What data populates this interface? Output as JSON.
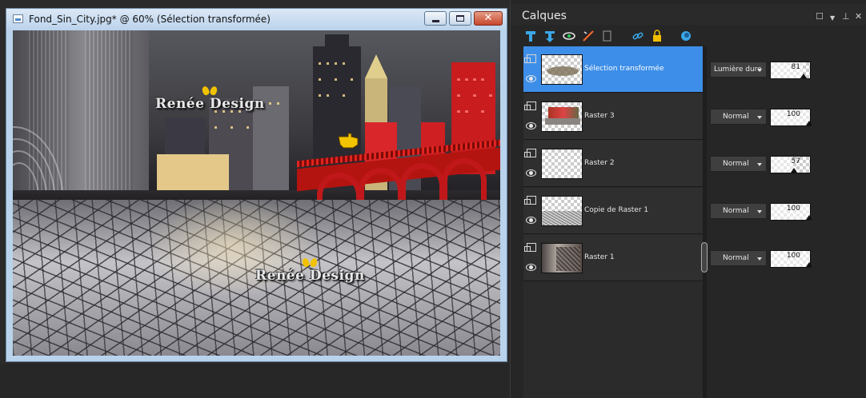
{
  "document": {
    "title": "Fond_Sin_City.jpg* @  60% (Sélection transformée)",
    "watermark": "Renée Design"
  },
  "layers_panel": {
    "title": "Calques",
    "layers": [
      {
        "name": "Sélection transformée",
        "blend": "Lumière dure",
        "opacity": "81",
        "selected": true
      },
      {
        "name": "Raster 3",
        "blend": "Normal",
        "opacity": "100",
        "selected": false
      },
      {
        "name": "Raster 2",
        "blend": "Normal",
        "opacity": "57",
        "selected": false
      },
      {
        "name": "Copie de Raster 1",
        "blend": "Normal",
        "opacity": "100",
        "selected": false
      },
      {
        "name": "Raster 1",
        "blend": "Normal",
        "opacity": "100",
        "selected": false
      }
    ]
  },
  "colors": {
    "selection": "#3d8ee8",
    "panel_bg": "#262626",
    "bridge_red": "#c0181a",
    "window_frame": "#b9d3ec"
  }
}
